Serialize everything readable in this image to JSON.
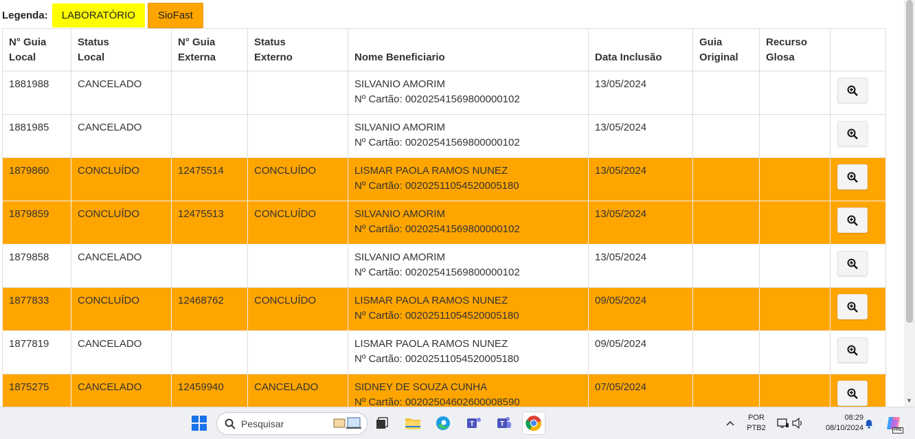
{
  "legend": {
    "label": "Legenda:",
    "items": [
      {
        "label": "LABORATÓRIO",
        "color": "#ffff00"
      },
      {
        "label": "SioFast",
        "color": "#ffa500"
      }
    ]
  },
  "table": {
    "headers": [
      "N° Guia Local",
      "Status Local",
      "N° Guia Externa",
      "Status Externo",
      "Nome Beneficiario",
      "Data Inclusão",
      "Guia Original",
      "Recurso Glosa",
      ""
    ],
    "header_lines": [
      [
        "N° Guia",
        "Local"
      ],
      [
        "Status",
        "Local"
      ],
      [
        "N° Guia",
        "Externa"
      ],
      [
        "Status",
        "Externo"
      ],
      [
        "",
        "Nome Beneficiario"
      ],
      [
        "",
        "Data Inclusão"
      ],
      [
        "Guia",
        "Original"
      ],
      [
        "Recurso",
        "Glosa"
      ]
    ],
    "card_prefix": "Nº Cartão: ",
    "rows": [
      {
        "guia_local": "1881988",
        "status_local": "CANCELADO",
        "guia_externa": "",
        "status_externo": "",
        "nome": "SILVANIO AMORIM",
        "cartao": "Nº Cartão: 00202541569800000102",
        "data": "13/05/2024",
        "guia_original": "",
        "recurso_glosa": "",
        "highlight": "none"
      },
      {
        "guia_local": "1881985",
        "status_local": "CANCELADO",
        "guia_externa": "",
        "status_externo": "",
        "nome": "SILVANIO AMORIM",
        "cartao": "Nº Cartão: 00202541569800000102",
        "data": "13/05/2024",
        "guia_original": "",
        "recurso_glosa": "",
        "highlight": "none"
      },
      {
        "guia_local": "1879860",
        "status_local": "CONCLUÍDO",
        "guia_externa": "12475514",
        "status_externo": "CONCLUÍDO",
        "nome": "LISMAR PAOLA RAMOS NUNEZ",
        "cartao": "Nº Cartão: 00202511054520005180",
        "data": "13/05/2024",
        "guia_original": "",
        "recurso_glosa": "",
        "highlight": "siofast"
      },
      {
        "guia_local": "1879859",
        "status_local": "CONCLUÍDO",
        "guia_externa": "12475513",
        "status_externo": "CONCLUÍDO",
        "nome": "SILVANIO AMORIM",
        "cartao": "Nº Cartão: 00202541569800000102",
        "data": "13/05/2024",
        "guia_original": "",
        "recurso_glosa": "",
        "highlight": "siofast"
      },
      {
        "guia_local": "1879858",
        "status_local": "CANCELADO",
        "guia_externa": "",
        "status_externo": "",
        "nome": "SILVANIO AMORIM",
        "cartao": "Nº Cartão: 00202541569800000102",
        "data": "13/05/2024",
        "guia_original": "",
        "recurso_glosa": "",
        "highlight": "none"
      },
      {
        "guia_local": "1877833",
        "status_local": "CONCLUÍDO",
        "guia_externa": "12468762",
        "status_externo": "CONCLUÍDO",
        "nome": "LISMAR PAOLA RAMOS NUNEZ",
        "cartao": "Nº Cartão: 00202511054520005180",
        "data": "09/05/2024",
        "guia_original": "",
        "recurso_glosa": "",
        "highlight": "siofast"
      },
      {
        "guia_local": "1877819",
        "status_local": "CANCELADO",
        "guia_externa": "",
        "status_externo": "",
        "nome": "LISMAR PAOLA RAMOS NUNEZ",
        "cartao": "Nº Cartão: 00202511054520005180",
        "data": "09/05/2024",
        "guia_original": "",
        "recurso_glosa": "",
        "highlight": "none"
      },
      {
        "guia_local": "1875275",
        "status_local": "CANCELADO",
        "guia_externa": "12459940",
        "status_externo": "CANCELADO",
        "nome": "SIDNEY DE SOUZA CUNHA",
        "cartao": "Nº Cartão: 00202504602600008590",
        "data": "07/05/2024",
        "guia_original": "",
        "recurso_glosa": "",
        "highlight": "siofast"
      }
    ]
  },
  "taskbar": {
    "search_placeholder": "Pesquisar",
    "language": "POR",
    "layout": "PTB2",
    "time": "08:29",
    "date": "08/10/2024",
    "copilot_badge": "PRE",
    "icons": [
      "windows-start-icon",
      "search-icon",
      "task-view-icon",
      "file-explorer-icon",
      "edge-icon",
      "teams-icon",
      "teams-work-icon",
      "chrome-icon"
    ]
  }
}
